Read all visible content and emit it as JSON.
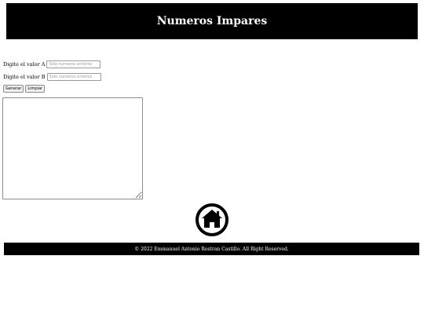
{
  "header": {
    "title": "Numeros Impares"
  },
  "form": {
    "field_a": {
      "label": "Digite el valor A",
      "value": "",
      "placeholder": "Solo numeros enteros"
    },
    "field_b": {
      "label": "Digite el valor B",
      "value": "",
      "placeholder": "Solo numeros enteros"
    },
    "generate_label": "Generar",
    "clear_label": "Limpiar"
  },
  "output": {
    "value": ""
  },
  "home": {
    "icon": "home-icon"
  },
  "footer": {
    "text": "© 2022 Emmanuel Antonio Rostran Castillo. All Right Reserved."
  }
}
